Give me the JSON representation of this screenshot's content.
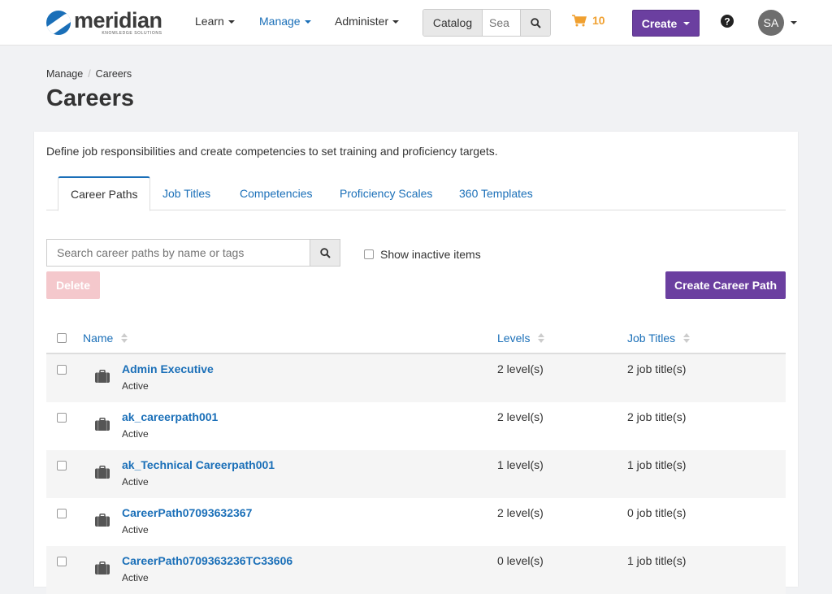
{
  "brand": {
    "name": "meridian",
    "tagline": "KNOWLEDGE SOLUTIONS",
    "accent": "#1a6fb8",
    "primary": "#6b3fa0"
  },
  "nav": {
    "learn": "Learn",
    "manage": "Manage",
    "administer": "Administer",
    "catalog": "Catalog",
    "catalog_search_placeholder": "Sea",
    "cart_count": "10",
    "create": "Create",
    "avatar_initials": "SA"
  },
  "breadcrumb": {
    "root": "Manage",
    "current": "Careers"
  },
  "page_title": "Careers",
  "description": "Define job responsibilities and create competencies to set training and proficiency targets.",
  "tabs": [
    "Career Paths",
    "Job Titles",
    "Competencies",
    "Proficiency Scales",
    "360 Templates"
  ],
  "search": {
    "placeholder": "Search career paths by name or tags"
  },
  "show_inactive_label": "Show inactive items",
  "delete_label": "Delete",
  "create_path_label": "Create Career Path",
  "table": {
    "columns": {
      "name": "Name",
      "levels": "Levels",
      "job_titles": "Job Titles"
    },
    "rows": [
      {
        "name": "Admin Executive",
        "status": "Active",
        "levels": "2 level(s)",
        "job_titles": "2 job title(s)"
      },
      {
        "name": "ak_careerpath001",
        "status": "Active",
        "levels": "2 level(s)",
        "job_titles": "2 job title(s)"
      },
      {
        "name": "ak_Technical Careerpath001",
        "status": "Active",
        "levels": "1 level(s)",
        "job_titles": "1 job title(s)"
      },
      {
        "name": "CareerPath07093632367",
        "status": "Active",
        "levels": "2 level(s)",
        "job_titles": "0 job title(s)"
      },
      {
        "name": "CareerPath0709363236TC33606",
        "status": "Active",
        "levels": "0 level(s)",
        "job_titles": "1 job title(s)"
      }
    ]
  }
}
